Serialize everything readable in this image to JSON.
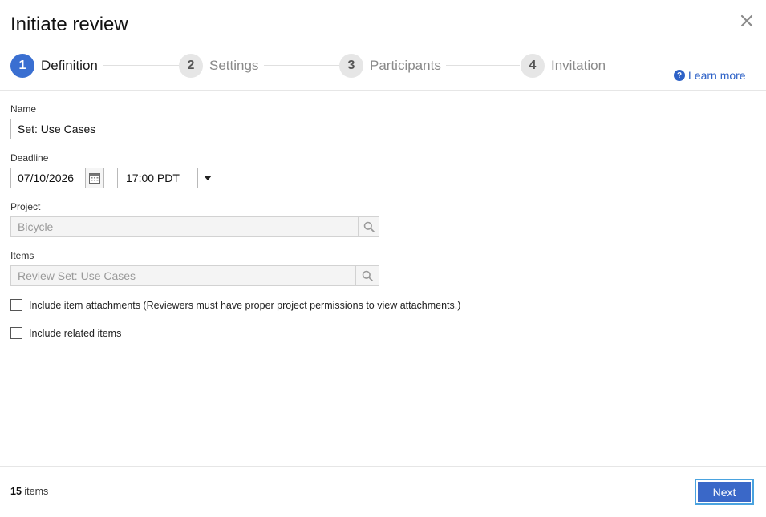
{
  "dialog": {
    "title": "Initiate review"
  },
  "steps": [
    {
      "number": "1",
      "label": "Definition"
    },
    {
      "number": "2",
      "label": "Settings"
    },
    {
      "number": "3",
      "label": "Participants"
    },
    {
      "number": "4",
      "label": "Invitation"
    }
  ],
  "learn_more": {
    "label": "Learn more"
  },
  "form": {
    "name": {
      "label": "Name",
      "value": "Set: Use Cases"
    },
    "deadline": {
      "label": "Deadline",
      "date": "07/10/2026",
      "time": "17:00 PDT"
    },
    "project": {
      "label": "Project",
      "placeholder": "Bicycle"
    },
    "items": {
      "label": "Items",
      "placeholder": "Review Set: Use Cases"
    },
    "include_attachments": {
      "label": "Include item attachments (Reviewers must have proper project permissions to view attachments.)",
      "checked": false
    },
    "include_related": {
      "label": "Include related items",
      "checked": false
    }
  },
  "footer": {
    "count": "15",
    "count_suffix": "items",
    "next_label": "Next"
  },
  "colors": {
    "accent": "#3a6fd1",
    "link": "#2e62c7",
    "focus_ring": "#4aa3df"
  }
}
